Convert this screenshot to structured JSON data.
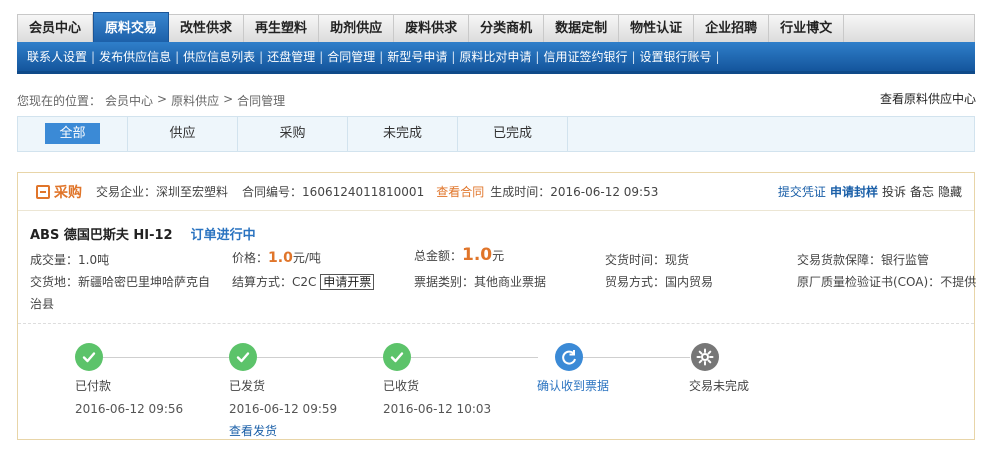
{
  "topnav": {
    "tabs": [
      "会员中心",
      "原料交易",
      "改性供求",
      "再生塑料",
      "助剂供应",
      "废料供求",
      "分类商机",
      "数据定制",
      "物性认证",
      "企业招聘",
      "行业博文"
    ],
    "active_index": 1
  },
  "subnav": {
    "items": [
      "联系人设置",
      "发布供应信息",
      "供应信息列表",
      "还盘管理",
      "合同管理",
      "新型号申请",
      "原料比对申请",
      "信用证签约银行",
      "设置银行账号"
    ],
    "separator": "|"
  },
  "breadcrumb": {
    "prefix": "您现在的位置：",
    "items": [
      "会员中心",
      "原料供应",
      "合同管理"
    ],
    "separator": ">"
  },
  "supplier_center_link": "查看原料供应中心",
  "filters": {
    "items": [
      "全部",
      "供应",
      "采购",
      "未完成",
      "已完成"
    ],
    "active_index": 0
  },
  "order": {
    "type_label": "采购",
    "company_label": "交易企业：",
    "company": "深圳至宏塑料",
    "contract_label": "合同编号：",
    "contract_no": "1606124011810001",
    "view_contract": "查看合同",
    "created_label": "生成时间：",
    "created_at": "2016-06-12 09:53",
    "actions": [
      "提交凭证",
      "申请封样",
      "投诉",
      "备忘",
      "隐藏"
    ],
    "product": "ABS 德国巴斯夫 HI-12",
    "status": "订单进行中",
    "volume_label": "成交量：",
    "volume": "1.0吨",
    "price_label": "价格：",
    "price": "1.0",
    "price_unit": "元/吨",
    "total_label": "总金额：",
    "total": "1.0",
    "total_unit": "元",
    "delivery_time_label": "交货时间：",
    "delivery_time": "现货",
    "guarantee_label": "交易货款保障：",
    "guarantee": "银行监管",
    "delivery_place_label": "交货地：",
    "delivery_place_1": "新疆哈密巴里坤哈萨克自",
    "delivery_place_2": "治县",
    "settlement_label": "结算方式：",
    "settlement": "C2C",
    "invoice_button": "申请开票",
    "ticket_label": "票据类别：",
    "ticket": "其他商业票据",
    "trade_mode_label": "贸易方式：",
    "trade_mode": "国内贸易",
    "coa_label": "原厂质量检验证书(COA)：",
    "coa": "不提供"
  },
  "steps": [
    {
      "label": "已付款",
      "date": "2016-06-12 09:56",
      "state": "done",
      "icon": "check-icon"
    },
    {
      "label": "已发货",
      "date": "2016-06-12 09:59",
      "state": "done",
      "icon": "check-icon",
      "link": "查看发货"
    },
    {
      "label": "已收货",
      "date": "2016-06-12 10:03",
      "state": "done",
      "icon": "check-icon"
    },
    {
      "label": "确认收到票据",
      "date": "",
      "state": "doing",
      "icon": "refresh-icon"
    },
    {
      "label": "交易未完成",
      "date": "",
      "state": "todo",
      "icon": "gear-icon"
    }
  ],
  "colors": {
    "nav_blue": "#1c5fa8",
    "accent_orange": "#e0752a",
    "done_green": "#5cc36a",
    "doing_blue": "#3b8ad6",
    "todo_gray": "#777777"
  }
}
